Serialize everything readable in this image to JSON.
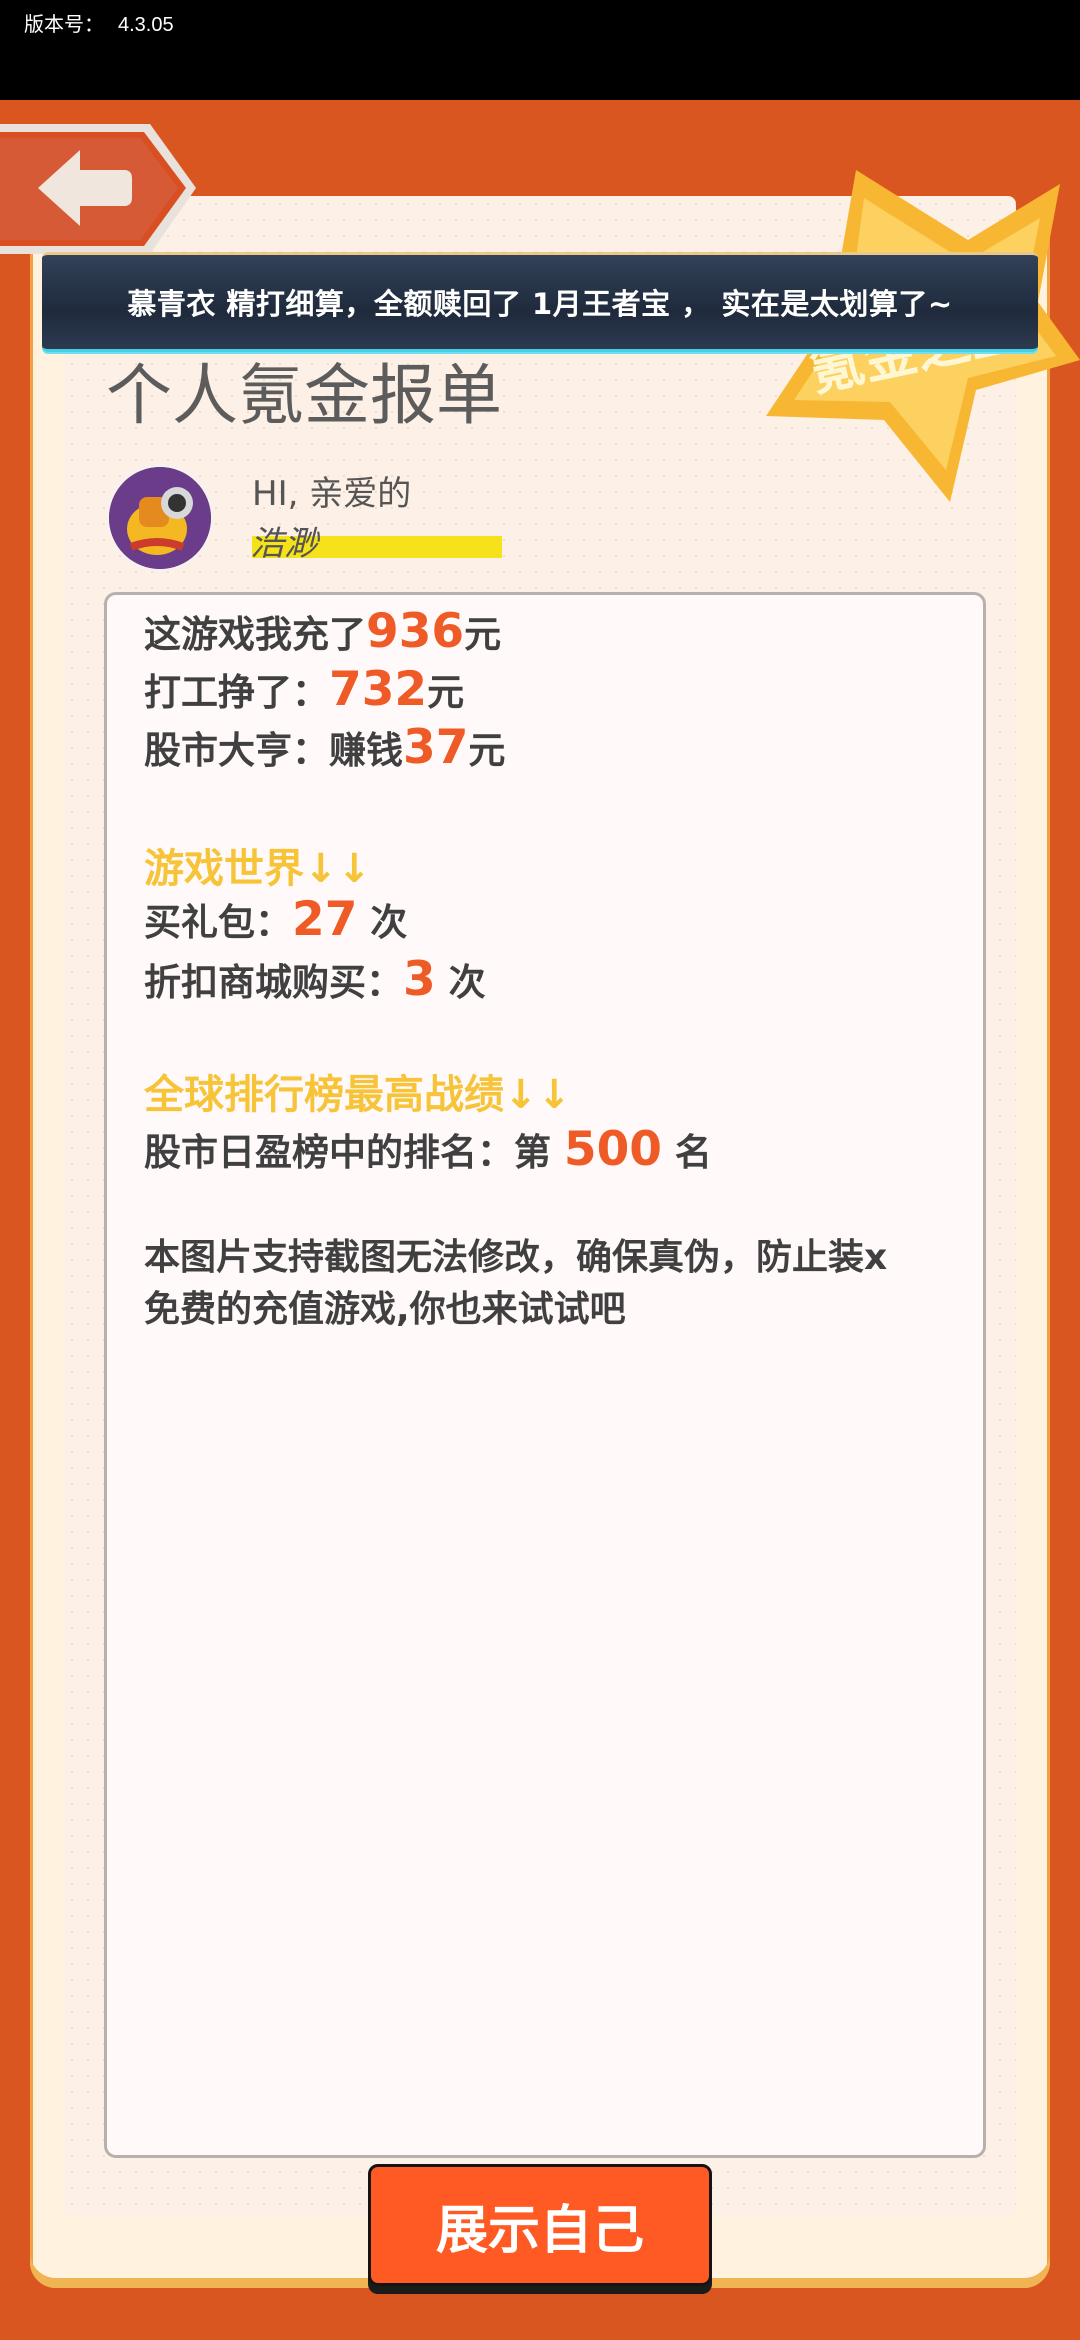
{
  "status_bar": {
    "version_label": "版本号：",
    "version_value": "4.3.05"
  },
  "banner": {
    "text": "慕青衣 精打细算，全额赎回了 1月王者宝 ， 实在是太划算了~"
  },
  "report": {
    "title": "个人氪金报单",
    "badge_text": "氪金之王"
  },
  "profile": {
    "greeting": "HI, 亲爱的",
    "username": "浩渺"
  },
  "stats": {
    "recharge": {
      "prefix": "这游戏我充了",
      "value": "936",
      "unit": "元"
    },
    "work": {
      "prefix": "打工挣了：",
      "value": "732",
      "unit": "元"
    },
    "stock": {
      "prefix": "股市大亨：赚钱",
      "value": "37",
      "unit": "元"
    }
  },
  "game_world": {
    "heading": "游戏世界↓↓",
    "gift": {
      "prefix": "买礼包：",
      "value": "27",
      "unit": " 次"
    },
    "discount": {
      "prefix": "折扣商城购买：",
      "value": "3",
      "unit": " 次"
    }
  },
  "ranking": {
    "heading": "全球排行榜最高战绩↓↓",
    "prefix": "股市日盈榜中的排名：第 ",
    "value": "500",
    "unit": " 名"
  },
  "note": {
    "line1": "本图片支持截图无法修改，确保真伪，防止装x",
    "line2": "免费的充值游戏,你也来试试吧"
  },
  "actions": {
    "show_label": "展示自己"
  },
  "colors": {
    "accent": "#ee5b27",
    "heading": "#f7c338",
    "background": "#da5621",
    "button": "#ff5a24"
  }
}
